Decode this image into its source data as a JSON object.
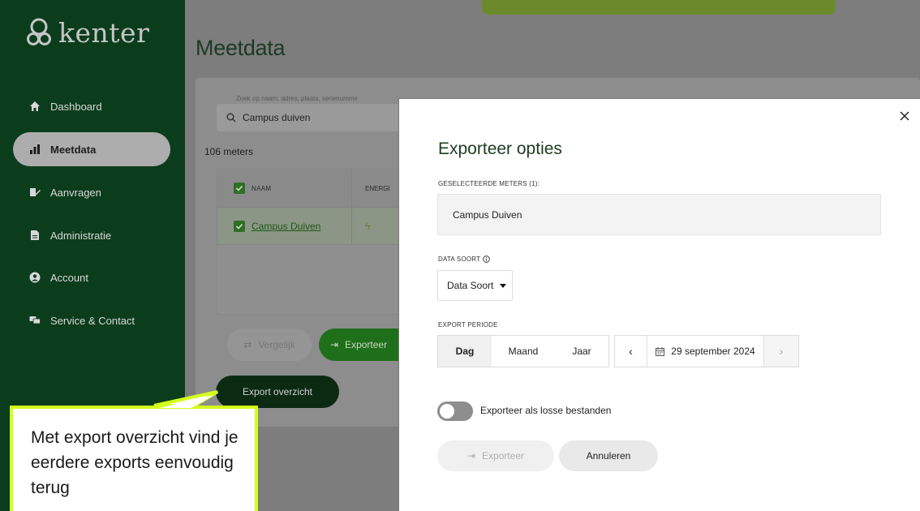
{
  "app": {
    "logo_text": "kenter"
  },
  "sidebar": {
    "items": [
      {
        "label": "Dashboard",
        "icon": "home-icon"
      },
      {
        "label": "Meetdata",
        "icon": "bar-chart-icon",
        "active": true
      },
      {
        "label": "Aanvragen",
        "icon": "edit-document-icon"
      },
      {
        "label": "Administratie",
        "icon": "document-icon"
      },
      {
        "label": "Account",
        "icon": "user-circle-icon"
      },
      {
        "label": "Service & Contact",
        "icon": "chat-icon"
      }
    ]
  },
  "main": {
    "title": "Meetdata",
    "search": {
      "hint": "Zoek op naam, adres, plaats, serienumme",
      "value": "Campus duiven"
    },
    "meters_count": "106 meters",
    "table": {
      "headers": [
        "NAAM",
        "ENERGI"
      ],
      "rows": [
        {
          "naam": "Campus Duiven"
        }
      ]
    },
    "buttons": {
      "vergelijk": "Vergelijk",
      "exporteer": "Exporteer",
      "export_overzicht": "Export overzicht"
    }
  },
  "callout": {
    "text": "Met export overzicht vind je eerdere exports eenvoudig terug",
    "border_color": "#d4ff1a"
  },
  "modal": {
    "title": "Exporteer opties",
    "selected_label": "GESELECTEERDE METERS (1):",
    "selected_value": "Campus Duiven",
    "data_soort_label": "DATA SOORT",
    "data_soort_value": "Data Soort",
    "export_periode_label": "EXPORT PERIODE",
    "periods": [
      "Dag",
      "Maand",
      "Jaar"
    ],
    "active_period": "Dag",
    "date": "29 september 2024",
    "toggle_label": "Exporteer als losse bestanden",
    "toggle_on": false,
    "btn_exporteer": "Exporteer",
    "btn_annuleren": "Annuleren"
  }
}
